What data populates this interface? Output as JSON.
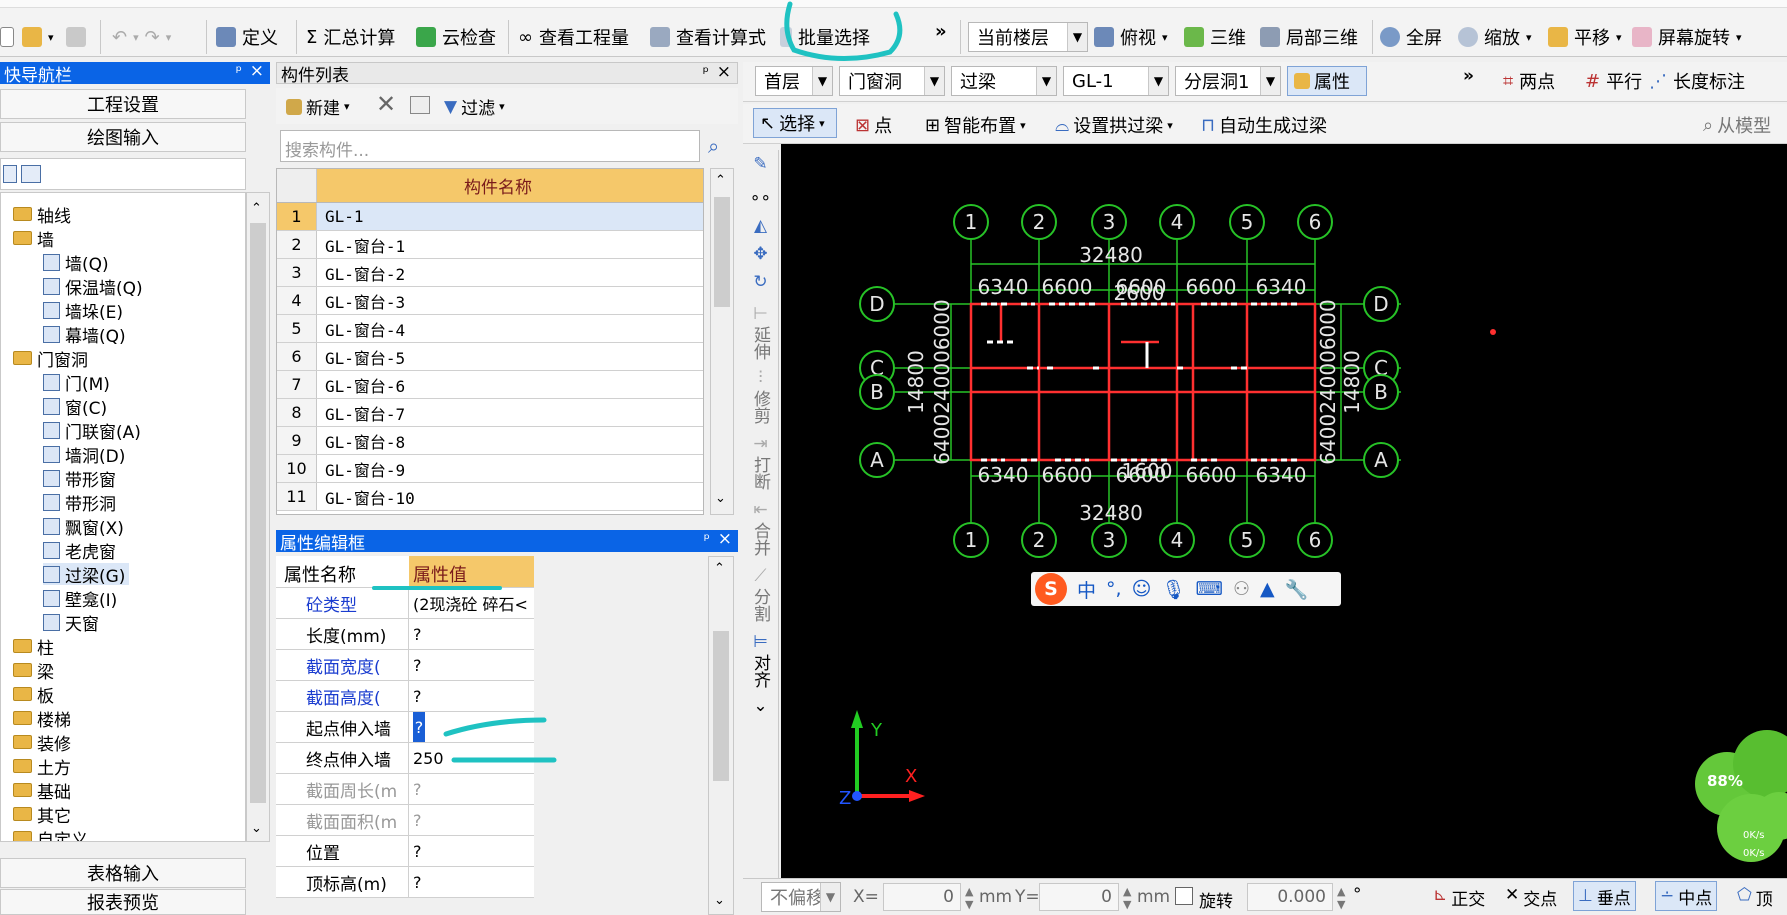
{
  "toolbar": {
    "define": "定义",
    "summary": "汇总计算",
    "cloudcheck": "云检查",
    "viewqty": "查看工程量",
    "viewformula": "查看计算式",
    "batchselect": "批量选择",
    "floor_combo": "当前楼层",
    "topview": "俯视",
    "threed": "三维",
    "local3d": "局部三维",
    "fullscreen": "全屏",
    "zoom": "缩放",
    "pan": "平移",
    "rotate": "屏幕旋转",
    "more": "»"
  },
  "toolbar2": {
    "combo_floor": "首层",
    "combo_cat": "门窗洞",
    "combo_type": "过梁",
    "combo_item": "GL-1",
    "combo_layer": "分层洞1",
    "attr_btn": "属性",
    "twopoint": "两点",
    "parallel": "平行",
    "dimlen": "长度标注",
    "select": "选择",
    "point": "点",
    "smartplace": "智能布置",
    "setarch": "设置拱过梁",
    "autogen": "自动生成过梁",
    "frommodel": "从模型"
  },
  "nav": {
    "title": "快导航栏",
    "pin": "ቐ",
    "close": "×",
    "btn_project": "工程设置",
    "btn_draw": "绘图输入",
    "btn_table": "表格输入",
    "btn_report": "报表预览",
    "tree": [
      {
        "label": "轴线",
        "lvl": 0
      },
      {
        "label": "墙",
        "lvl": 0
      },
      {
        "label": "墙(Q)",
        "lvl": 1
      },
      {
        "label": "保温墙(Q)",
        "lvl": 1
      },
      {
        "label": "墙垛(E)",
        "lvl": 1
      },
      {
        "label": "幕墙(Q)",
        "lvl": 1
      },
      {
        "label": "门窗洞",
        "lvl": 0
      },
      {
        "label": "门(M)",
        "lvl": 1
      },
      {
        "label": "窗(C)",
        "lvl": 1
      },
      {
        "label": "门联窗(A)",
        "lvl": 1
      },
      {
        "label": "墙洞(D)",
        "lvl": 1
      },
      {
        "label": "带形窗",
        "lvl": 1
      },
      {
        "label": "带形洞",
        "lvl": 1
      },
      {
        "label": "飘窗(X)",
        "lvl": 1
      },
      {
        "label": "老虎窗",
        "lvl": 1
      },
      {
        "label": "过梁(G)",
        "lvl": 1
      },
      {
        "label": "壁龛(I)",
        "lvl": 1
      },
      {
        "label": "天窗",
        "lvl": 1
      },
      {
        "label": "柱",
        "lvl": 0
      },
      {
        "label": "梁",
        "lvl": 0
      },
      {
        "label": "板",
        "lvl": 0
      },
      {
        "label": "楼梯",
        "lvl": 0
      },
      {
        "label": "装修",
        "lvl": 0
      },
      {
        "label": "土方",
        "lvl": 0
      },
      {
        "label": "基础",
        "lvl": 0
      },
      {
        "label": "其它",
        "lvl": 0
      },
      {
        "label": "自定义",
        "lvl": 0
      }
    ]
  },
  "complist": {
    "title": "构件列表",
    "new": "新建",
    "filter": "过滤",
    "search_placeholder": "搜索构件...",
    "col_name": "构件名称",
    "rows": [
      {
        "no": "1",
        "name": "GL-1"
      },
      {
        "no": "2",
        "name": "GL-窗台-1"
      },
      {
        "no": "3",
        "name": "GL-窗台-2"
      },
      {
        "no": "4",
        "name": "GL-窗台-3"
      },
      {
        "no": "5",
        "name": "GL-窗台-4"
      },
      {
        "no": "6",
        "name": "GL-窗台-5"
      },
      {
        "no": "7",
        "name": "GL-窗台-6"
      },
      {
        "no": "8",
        "name": "GL-窗台-7"
      },
      {
        "no": "9",
        "name": "GL-窗台-8"
      },
      {
        "no": "10",
        "name": "GL-窗台-9"
      },
      {
        "no": "11",
        "name": "GL-窗台-10"
      }
    ]
  },
  "props": {
    "title": "属性编辑框",
    "col_name": "属性名称",
    "col_value": "属性值",
    "rows": [
      {
        "name": "砼类型",
        "value": "(2现浇砼 碎石<",
        "blue": true
      },
      {
        "name": "长度(mm)",
        "value": "?",
        "blue": false
      },
      {
        "name": "截面宽度(",
        "value": "?",
        "blue": true
      },
      {
        "name": "截面高度(",
        "value": "?",
        "blue": true
      },
      {
        "name": "起点伸入墙",
        "value": "?",
        "blue": false
      },
      {
        "name": "终点伸入墙",
        "value": "250",
        "blue": false
      },
      {
        "name": "截面周长(m",
        "value": "?",
        "blue": false,
        "gray": true
      },
      {
        "name": "截面面积(m",
        "value": "?",
        "blue": false,
        "gray": true
      },
      {
        "name": "位置",
        "value": "?",
        "blue": false
      },
      {
        "name": "顶标高(m)",
        "value": "?",
        "blue": false
      }
    ]
  },
  "vtools": {
    "extend": "延伸",
    "trim": "修剪",
    "break": "打断",
    "merge": "合并",
    "split": "分割",
    "align": "对齐"
  },
  "drawing": {
    "axis_top": [
      "1",
      "2",
      "3",
      "4",
      "5",
      "6"
    ],
    "axis_side": [
      "D",
      "C",
      "B",
      "A"
    ],
    "dim_total": "32480",
    "dims_top": [
      "6340",
      "6600",
      "6600",
      "6600",
      "6340"
    ],
    "dim_2600": "2600",
    "dim_left_14800": "14800",
    "dim_right_14800": "14800",
    "dim_side_left": "6400240006000",
    "dim_side_right": "6400240006000",
    "dims_bottom": [
      "6340",
      "6600",
      "6600",
      "6600",
      "6340"
    ],
    "dim_1600": "1600",
    "dim_bottom_total": "32480",
    "ucs_y": "Y",
    "ucs_x": "X",
    "ucs_z": "Z"
  },
  "ime": {
    "logo": "S",
    "lang": "中",
    "punc": "°,"
  },
  "netwidget": {
    "percent": "88%",
    "up": "0K/s",
    "down": "0K/s"
  },
  "status": {
    "offset": "不偏移",
    "x_label": "X=",
    "x_val": "0",
    "unit_mm": "mm",
    "y_label": "Y=",
    "y_val": "0",
    "unit_mm2": "mm",
    "rotate_label": "旋转",
    "rotate_val": "0.000",
    "deg": "°",
    "ortho": "正交",
    "intersect": "交点",
    "perp": "垂点",
    "mid": "中点",
    "top": "顶"
  },
  "colors": {
    "accent_blue": "#0a64e6",
    "grid_header": "#f5c86a",
    "highlight_cyan": "#1fc2c2",
    "selected_row": "#dbe7f7"
  }
}
